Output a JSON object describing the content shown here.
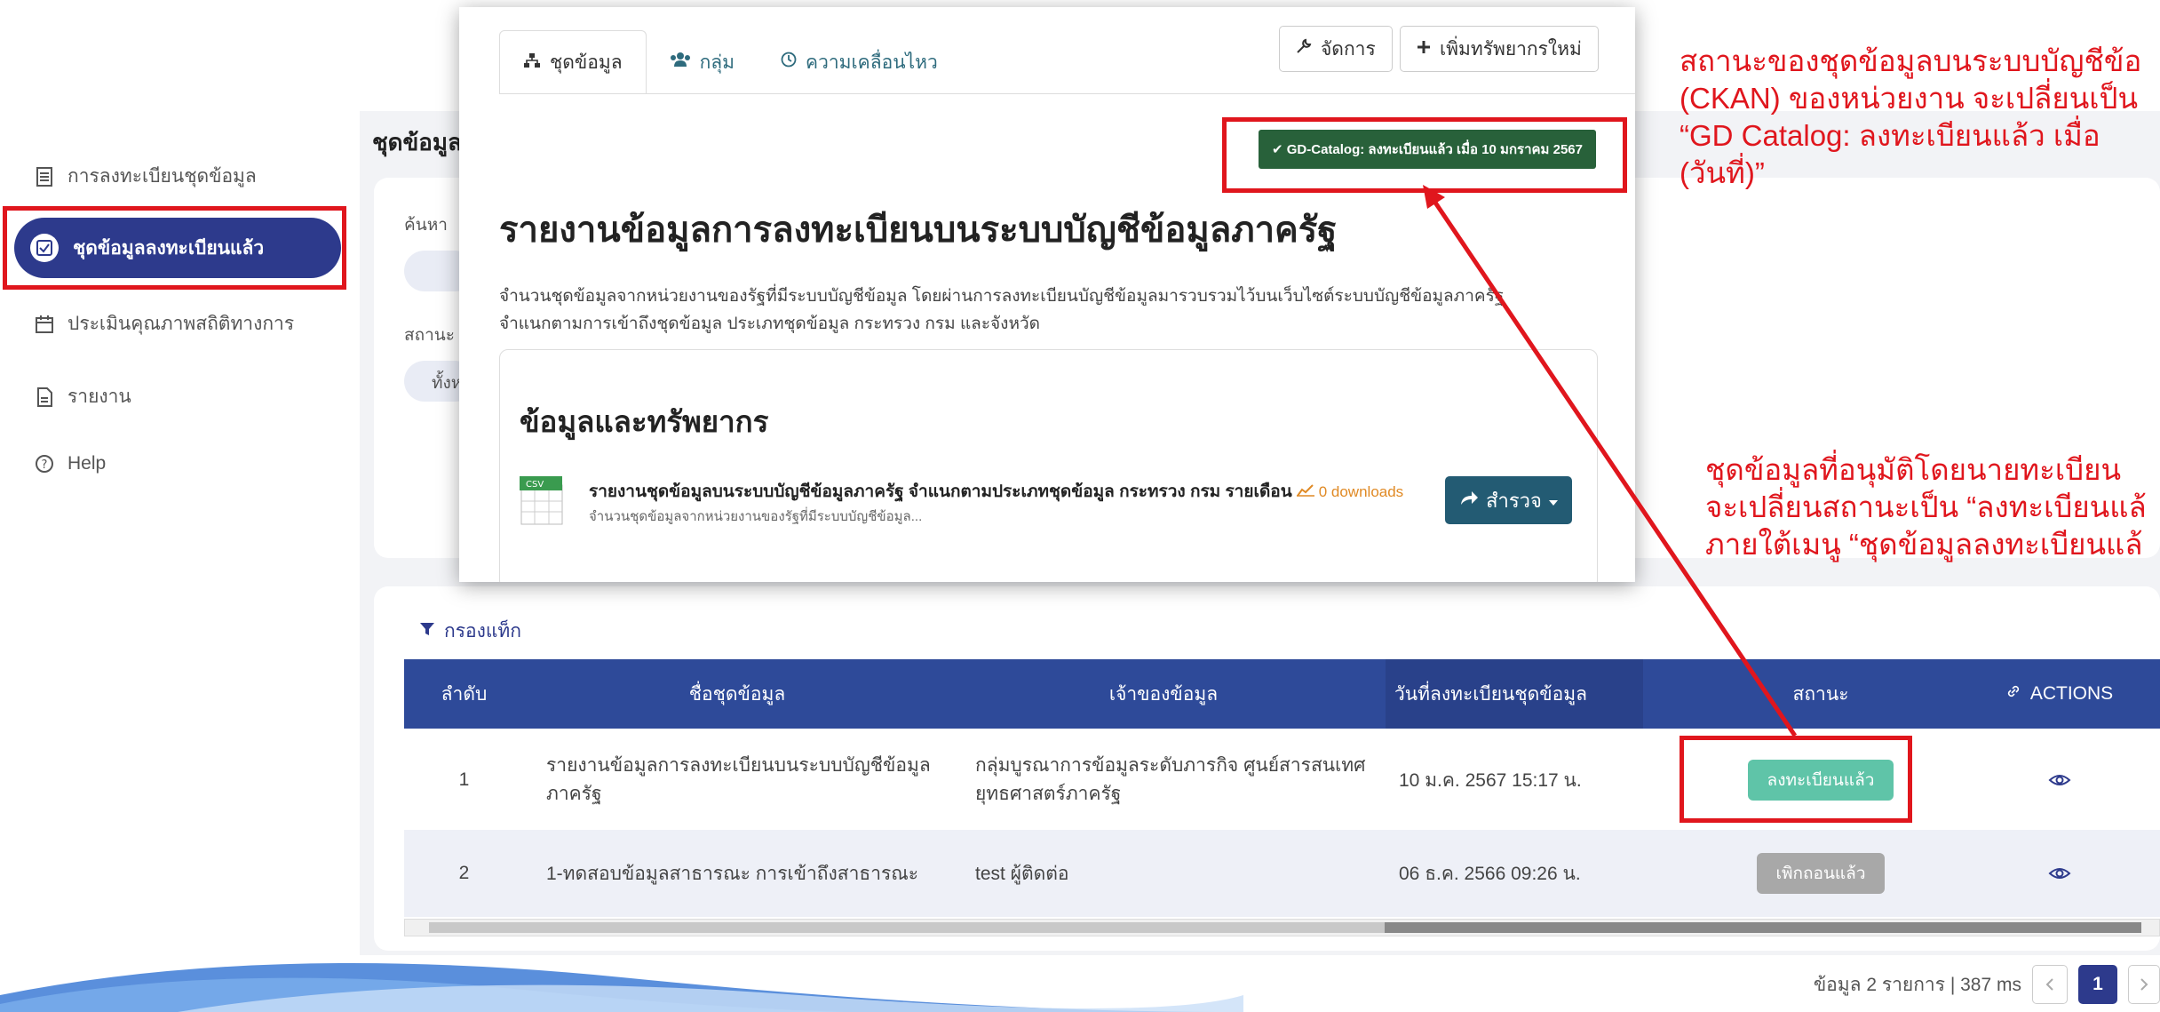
{
  "sidebar": {
    "items": [
      {
        "label": "การลงทะเบียนชุดข้อมูล",
        "icon": "register-list-icon"
      },
      {
        "label": "ชุดข้อมูลลงทะเบียนแล้ว",
        "icon": "checkbox-icon",
        "active": true
      },
      {
        "label": "ประเมินคุณภาพสถิติทางการ",
        "icon": "calendar-icon"
      },
      {
        "label": "รายงาน",
        "icon": "report-icon"
      },
      {
        "label": "Help",
        "icon": "help-circle-icon"
      }
    ]
  },
  "main": {
    "title_fragment": "ชุดข้อมูล",
    "search_label_fragment": "ค้นหา",
    "status_label_fragment": "สถานะ",
    "status_pill_fragment": "ทั้งห"
  },
  "popup": {
    "tabs": [
      {
        "label": "ชุดข้อมูล",
        "icon": "sitemap-icon",
        "active": true
      },
      {
        "label": "กลุ่ม",
        "icon": "users-icon"
      },
      {
        "label": "ความเคลื่อนไหว",
        "icon": "clock-icon"
      }
    ],
    "manage_button": "จัดการ",
    "add_resource_button": "เพิ่มทรัพยากรใหม่",
    "gd_status": "✔ GD-Catalog: ลงทะเบียนแล้ว เมื่อ 10 มกราคม 2567",
    "heading": "รายงานข้อมูลการลงทะเบียนบนระบบบัญชีข้อมูลภาครัฐ",
    "description_line1": "จำนวนชุดข้อมูลจากหน่วยงานของรัฐที่มีระบบบัญชีข้อมูล โดยผ่านการลงทะเบียนบัญชีข้อมูลมารวบรวมไว้บนเว็บไซต์ระบบบัญชีข้อมูลภาครัฐ",
    "description_line2": "จำแนกตามการเข้าถึงชุดข้อมูล ประเภทชุดข้อมูล กระทรวง กรม และจังหวัด",
    "resources_heading": "ข้อมูลและทรัพยากร",
    "resource": {
      "format": "CSV",
      "title": "รายงานชุดข้อมูลบนระบบบัญชีข้อมูลภาครัฐ จำแนกตามประเภทชุดข้อมูล กระทรวง กรม รายเดือน",
      "downloads": "0 downloads",
      "subtitle": "จำนวนชุดข้อมูลจากหน่วยงานของรัฐที่มีระบบบัญชีข้อมูล..."
    },
    "explore_button": "สำรวจ"
  },
  "table": {
    "filter_tags_label": "กรองแท็ก",
    "columns": [
      "ลำดับ",
      "ชื่อชุดข้อมูล",
      "เจ้าของข้อมูล",
      "วันที่ลงทะเบียนชุดข้อมูล",
      "สถานะ",
      "ACTIONS"
    ],
    "rows": [
      {
        "no": "1",
        "name_line1": "รายงานข้อมูลการลงทะเบียนบนระบบบัญชีข้อมูล",
        "name_line2": "ภาครัฐ",
        "owner_line1": "กลุ่มบูรณาการข้อมูลระดับภารกิจ ศูนย์สารสนเทศ",
        "owner_line2": "ยุทธศาสตร์ภาครัฐ",
        "date": "10 ม.ค. 2567 15:17 น.",
        "status": "ลงทะเบียนแล้ว",
        "status_color": "#5fc4a8"
      },
      {
        "no": "2",
        "name_line1": "1-ทดสอบข้อมูลสาธารณะ การเข้าถึงสาธารณะ",
        "name_line2": "",
        "owner_line1": "test ผู้ติดต่อ",
        "owner_line2": "",
        "date": "06 ธ.ค. 2566 09:26 น.",
        "status": "เพิกถอนแล้ว",
        "status_color": "#a8a8a8"
      }
    ],
    "footer_info": "ข้อมูล 2 รายการ | 387 ms",
    "current_page": "1"
  },
  "annotations": {
    "top_right": [
      "สถานะของชุดข้อมูลบนระบบบัญชีข้อ",
      "(CKAN) ของหน่วยงาน จะเปลี่ยนเป็น",
      "“GD Catalog: ลงทะเบียนแล้ว เมื่อ",
      "(วันที่)”"
    ],
    "mid_right": [
      "ชุดข้อมูลที่อนุมัติโดยนายทะเบียน",
      "จะเปลี่ยนสถานะเป็น “ลงทะเบียนแล้",
      "ภายใต้เมนู “ชุดข้อมูลลงทะเบียนแล้"
    ],
    "color": "#e0161d"
  }
}
